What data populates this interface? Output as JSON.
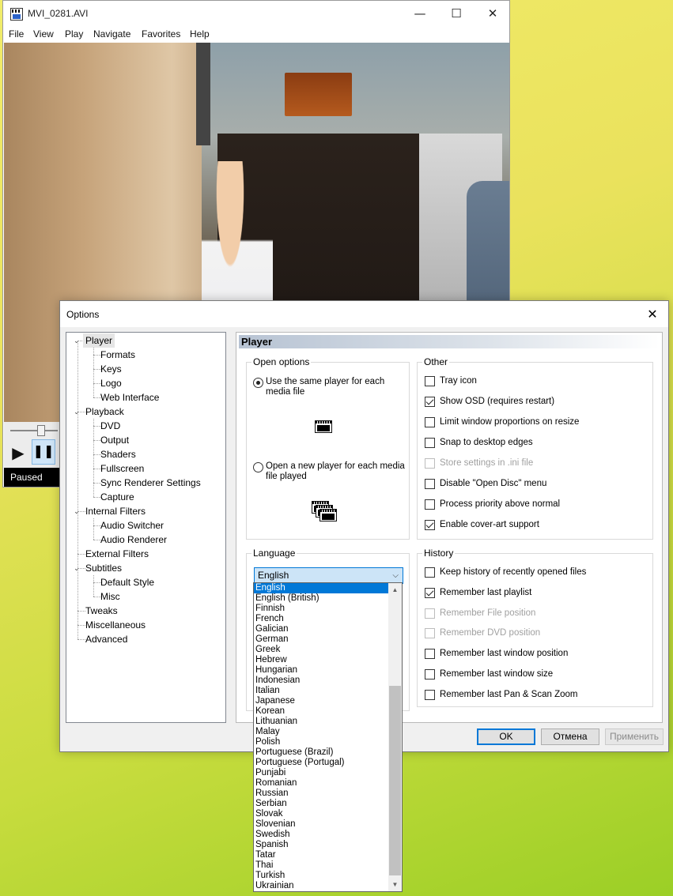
{
  "player": {
    "title": "MVI_0281.AVI",
    "menu": [
      "File",
      "View",
      "Play",
      "Navigate",
      "Favorites",
      "Help"
    ],
    "status": "Paused",
    "caption_minimize": "—",
    "caption_maximize": "☐",
    "caption_close": "✕",
    "play_glyph": "▶",
    "pause_glyph": "❚❚",
    "seek_fraction": 0.75
  },
  "dialog": {
    "title": "Options",
    "close_glyph": "✕",
    "tree": [
      {
        "label": "Player",
        "level": 0,
        "expanded": true,
        "selected": true
      },
      {
        "label": "Formats",
        "level": 1
      },
      {
        "label": "Keys",
        "level": 1
      },
      {
        "label": "Logo",
        "level": 1
      },
      {
        "label": "Web Interface",
        "level": 1
      },
      {
        "label": "Playback",
        "level": 0,
        "expanded": true
      },
      {
        "label": "DVD",
        "level": 1
      },
      {
        "label": "Output",
        "level": 1
      },
      {
        "label": "Shaders",
        "level": 1
      },
      {
        "label": "Fullscreen",
        "level": 1
      },
      {
        "label": "Sync Renderer Settings",
        "level": 1
      },
      {
        "label": "Capture",
        "level": 1
      },
      {
        "label": "Internal Filters",
        "level": 0,
        "expanded": true
      },
      {
        "label": "Audio Switcher",
        "level": 1
      },
      {
        "label": "Audio Renderer",
        "level": 1
      },
      {
        "label": "External Filters",
        "level": 0
      },
      {
        "label": "Subtitles",
        "level": 0,
        "expanded": true
      },
      {
        "label": "Default Style",
        "level": 1
      },
      {
        "label": "Misc",
        "level": 1
      },
      {
        "label": "Tweaks",
        "level": 0
      },
      {
        "label": "Miscellaneous",
        "level": 0
      },
      {
        "label": "Advanced",
        "level": 0
      }
    ],
    "page_title": "Player",
    "open_options": {
      "legend": "Open options",
      "same_player": "Use the same player for each media file",
      "new_player": "Open a new player for each media file played",
      "selected": "same_player"
    },
    "other": {
      "legend": "Other",
      "items": [
        {
          "label": "Tray icon",
          "checked": false,
          "enabled": true
        },
        {
          "label": "Show OSD (requires restart)",
          "checked": true,
          "enabled": true
        },
        {
          "label": "Limit window proportions on resize",
          "checked": false,
          "enabled": true
        },
        {
          "label": "Snap to desktop edges",
          "checked": false,
          "enabled": true
        },
        {
          "label": "Store settings in .ini file",
          "checked": false,
          "enabled": false
        },
        {
          "label": "Disable \"Open Disc\" menu",
          "checked": false,
          "enabled": true
        },
        {
          "label": "Process priority above normal",
          "checked": false,
          "enabled": true
        },
        {
          "label": "Enable cover-art support",
          "checked": true,
          "enabled": true
        }
      ]
    },
    "language": {
      "legend": "Language",
      "selected": "English",
      "arrow": "⌵",
      "options": [
        "English",
        "English (British)",
        "Finnish",
        "French",
        "Galician",
        "German",
        "Greek",
        "Hebrew",
        "Hungarian",
        "Indonesian",
        "Italian",
        "Japanese",
        "Korean",
        "Lithuanian",
        "Malay",
        "Polish",
        "Portuguese (Brazil)",
        "Portuguese (Portugal)",
        "Punjabi",
        "Romanian",
        "Russian",
        "Serbian",
        "Slovak",
        "Slovenian",
        "Swedish",
        "Spanish",
        "Tatar",
        "Thai",
        "Turkish",
        "Ukrainian"
      ]
    },
    "history": {
      "legend": "History",
      "items": [
        {
          "label": "Keep history of recently opened files",
          "checked": false,
          "enabled": true
        },
        {
          "label": "Remember last playlist",
          "checked": true,
          "enabled": true
        },
        {
          "label": "Remember File position",
          "checked": false,
          "enabled": false
        },
        {
          "label": "Remember DVD position",
          "checked": false,
          "enabled": false
        },
        {
          "label": "Remember last window position",
          "checked": false,
          "enabled": true
        },
        {
          "label": "Remember last window size",
          "checked": false,
          "enabled": true
        },
        {
          "label": "Remember last Pan & Scan Zoom",
          "checked": false,
          "enabled": true
        }
      ]
    },
    "buttons": {
      "ok": "OK",
      "cancel": "Отмена",
      "apply": "Применить"
    },
    "scroll_up": "▲",
    "scroll_down": "▼"
  }
}
